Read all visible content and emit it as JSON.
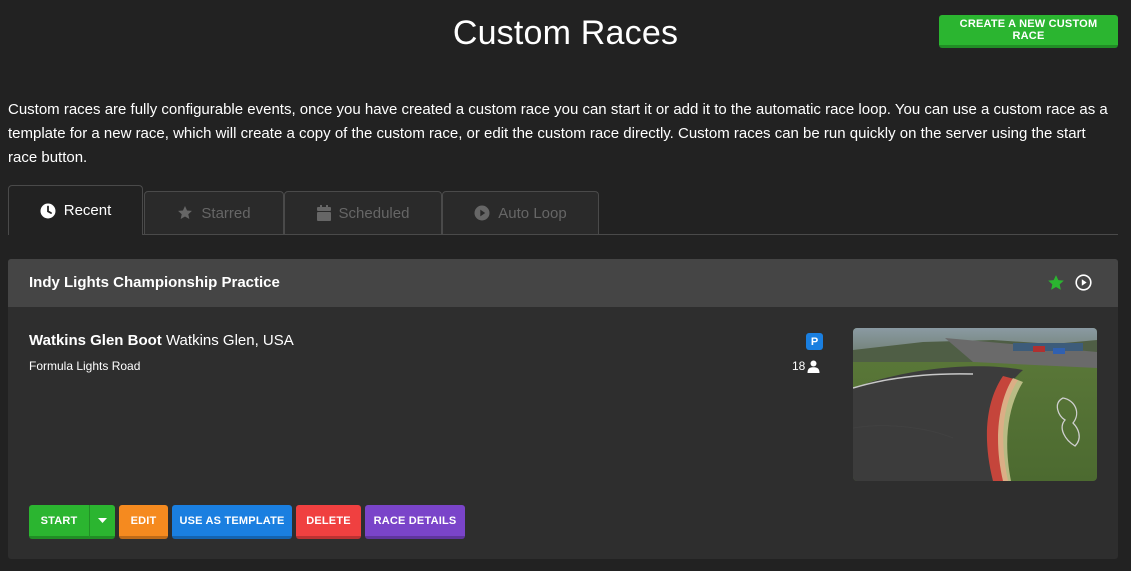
{
  "header": {
    "title": "Custom Races",
    "create_button": "Create a New Custom Race"
  },
  "intro": "Custom races are fully configurable events, once you have created a custom race you can start it or add it to the automatic race loop. You can use a custom race as a template for a new race, which will create a copy of the custom race, or edit the custom race directly. Custom races can be run quickly on the server using the start race button.",
  "tabs": [
    {
      "label": "Recent",
      "icon": "clock-icon",
      "active": true
    },
    {
      "label": "Starred",
      "icon": "star-icon",
      "active": false
    },
    {
      "label": "Scheduled",
      "icon": "calendar-icon",
      "active": false
    },
    {
      "label": "Auto Loop",
      "icon": "play-circle-icon",
      "active": false
    }
  ],
  "race": {
    "title": "Indy Lights Championship Practice",
    "track_name": "Watkins Glen Boot",
    "track_location": "Watkins Glen, USA",
    "car": "Formula Lights Road",
    "badge": "P",
    "players": "18",
    "starred": true
  },
  "actions": {
    "start": "Start",
    "edit": "Edit",
    "use_as_template": "Use as Template",
    "delete": "Delete",
    "race_details": "Race Details"
  },
  "colors": {
    "background": "#222222",
    "card": "#2e2e2e",
    "card_header": "#454545",
    "green": "#2bb530",
    "orange": "#f58a1f",
    "blue": "#1a7fe0",
    "red": "#f04040",
    "purple": "#7a44c9"
  }
}
